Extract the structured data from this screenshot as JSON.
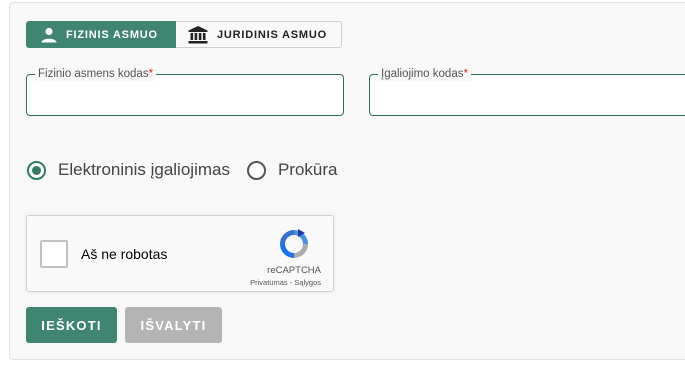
{
  "toggle": {
    "person_label": "FIZINIS ASMUO",
    "legal_label": "JURIDINIS ASMUO",
    "person_icon": "person-icon",
    "legal_icon": "institution-icon"
  },
  "fields": {
    "personal_code_label": "Fizinio asmens kodas",
    "authorization_code_label": "Įgaliojimo kodas",
    "required_mark": "*"
  },
  "auth_type": {
    "options": [
      "Elektroninis įgaliojimas",
      "Prokūra"
    ],
    "selected": "Elektroninis įgaliojimas"
  },
  "recaptcha": {
    "label": "Aš ne robotas",
    "brand": "reCAPTCHA",
    "privacy": "Privatumas",
    "separator": " - ",
    "terms": "Sąlygos"
  },
  "actions": {
    "search_label": "IEŠKOTI",
    "clear_label": "IŠVALYTI"
  },
  "colors": {
    "accent": "#3f8572",
    "disabled": "#b4b4b4",
    "required": "#d32f2f"
  }
}
